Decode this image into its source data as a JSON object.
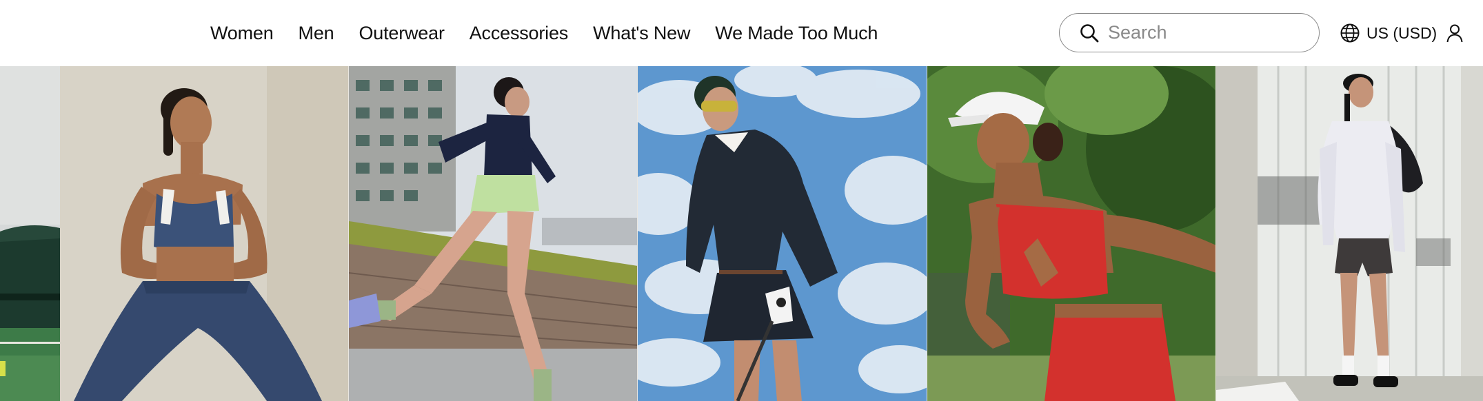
{
  "nav": {
    "items": [
      {
        "label": "Women"
      },
      {
        "label": "Men"
      },
      {
        "label": "Outerwear"
      },
      {
        "label": "Accessories"
      },
      {
        "label": "What's New"
      },
      {
        "label": "We Made Too Much"
      }
    ]
  },
  "search": {
    "placeholder": "Search",
    "value": ""
  },
  "locale": {
    "label": "US (USD)"
  },
  "gallery": {
    "tiles": [
      {
        "name": "tennis-court-edge",
        "alt": "Tennis court"
      },
      {
        "name": "yoga-pose",
        "alt": "Woman in blue sports bra and leggings doing a yoga pose"
      },
      {
        "name": "runner",
        "alt": "Runner in green shorts and navy top"
      },
      {
        "name": "golfer",
        "alt": "Golfer in navy sweater and skirt against cloudy sky"
      },
      {
        "name": "tennis-player",
        "alt": "Woman in red sports bra and shorts playing tennis"
      },
      {
        "name": "street-style",
        "alt": "Woman in white jacket and bike shorts with backpack"
      }
    ]
  },
  "colors": {
    "text": "#111111",
    "search_border": "#8a8a8a",
    "placeholder": "#8a8a8a",
    "background": "#ffffff"
  }
}
